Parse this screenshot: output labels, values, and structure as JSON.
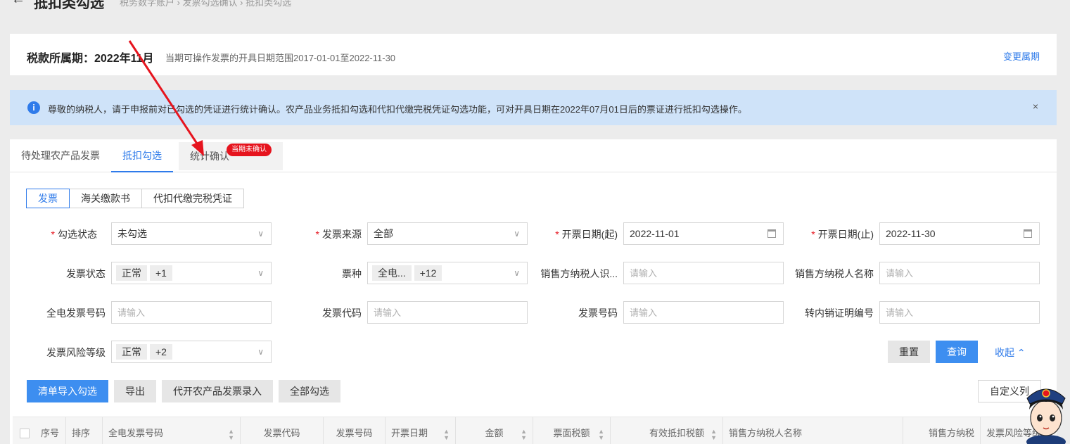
{
  "top": {
    "back_symbol": "←",
    "title": "抵扣类勾选",
    "breadcrumb": "税务数字账户  ›  发票勾选确认  ›  抵扣类勾选"
  },
  "period": {
    "label": "税款所属期：2022年11月",
    "range": "当期可操作发票的开具日期范围2017-01-01至2022-11-30",
    "change": "变更属期"
  },
  "notice": {
    "icon": "i",
    "text": "尊敬的纳税人，请于申报前对已勾选的凭证进行统计确认。农产品业务抵扣勾选和代扣代缴完税凭证勾选功能，可对开具日期在2022年07月01日后的票证进行抵扣勾选操作。",
    "close": "×"
  },
  "tabs": {
    "pending": "待处理农产品发票",
    "deduct": "抵扣勾选",
    "stats": "统计确认",
    "badge": "当期未确认"
  },
  "segments": {
    "invoice": "发票",
    "customs": "海关缴款书",
    "withholding": "代扣代缴完税凭证"
  },
  "filters": {
    "select_status_label": "勾选状态",
    "select_status_value": "未勾选",
    "source_label": "发票来源",
    "source_value": "全部",
    "date_start_label": "开票日期(起)",
    "date_start_value": "2022-11-01",
    "date_end_label": "开票日期(止)",
    "date_end_value": "2022-11-30",
    "invoice_status_label": "发票状态",
    "invoice_status_tag": "正常",
    "invoice_status_more": "+1",
    "type_label": "票种",
    "type_tag": "全电...",
    "type_more": "+12",
    "seller_id_label": "销售方纳税人识...",
    "seller_name_label": "销售方纳税人名称",
    "full_invoice_no_label": "全电发票号码",
    "invoice_code_label": "发票代码",
    "invoice_no_label": "发票号码",
    "transfer_no_label": "转内销证明编号",
    "risk_label": "发票风险等级",
    "risk_tag": "正常",
    "risk_more": "+2",
    "placeholder": "请输入"
  },
  "actions": {
    "reset": "重置",
    "query": "查询",
    "collapse": "收起",
    "import": "清单导入勾选",
    "export": "导出",
    "agent_entry": "代开农产品发票录入",
    "select_all": "全部勾选",
    "custom_cols": "自定义列"
  },
  "table": {
    "headers": [
      "序号",
      "排序",
      "全电发票号码",
      "发票代码",
      "发票号码",
      "开票日期",
      "金额",
      "票面税额",
      "有效抵扣税额",
      "销售方纳税人名称",
      "销售方纳税",
      "发票风险等级"
    ]
  },
  "icons": {
    "chevron": "chevron-down-icon",
    "calendar": "calendar-icon",
    "sort": "sort-icon"
  },
  "colors": {
    "primary": "#2f7bea",
    "badge": "#e6141e",
    "notice_bg": "#cfe3f9"
  }
}
